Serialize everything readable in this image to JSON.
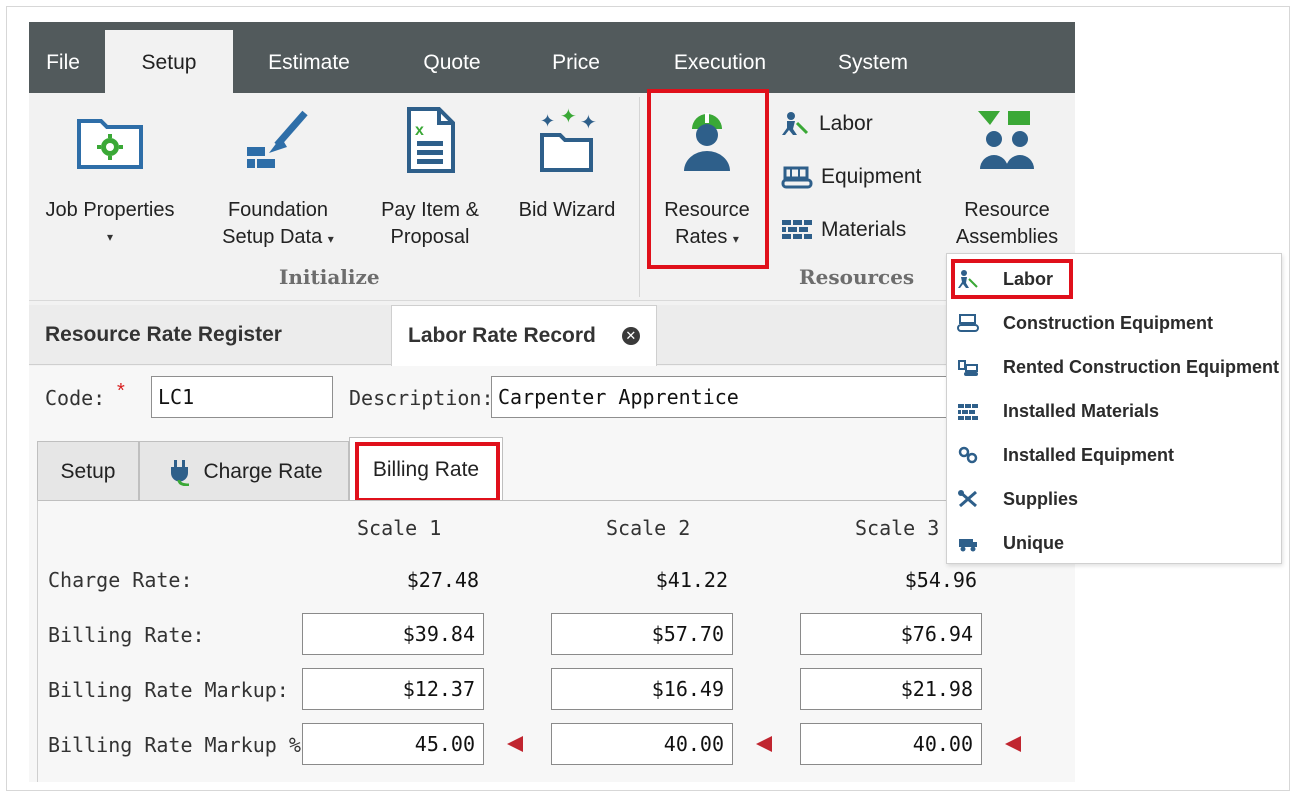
{
  "menu": {
    "tabs": [
      "File",
      "Setup",
      "Estimate",
      "Quote",
      "Price",
      "Execution",
      "System"
    ],
    "active": "Setup"
  },
  "ribbon": {
    "initialize": {
      "job_properties": "Job Properties",
      "foundation_line1": "Foundation",
      "foundation_line2": "Setup Data",
      "pay_item_line1": "Pay Item &",
      "pay_item_line2": "Proposal",
      "bid_wizard": "Bid Wizard",
      "group_label": "Initialize"
    },
    "resources": {
      "rates_line1": "Resource",
      "rates_line2": "Rates",
      "labor": "Labor",
      "equipment": "Equipment",
      "materials": "Materials",
      "assemblies_line1": "Resource",
      "assemblies_line2": "Assemblies",
      "group_label": "Resources"
    },
    "caret": "▾"
  },
  "doc_tabs": {
    "register": "Resource Rate Register",
    "record": "Labor Rate Record",
    "close": "✕"
  },
  "form": {
    "code_label": "Code:",
    "required_mark": "*",
    "code_value": "LC1",
    "description_label": "Description:",
    "description_value": "Carpenter Apprentice"
  },
  "sub_tabs": {
    "setup": "Setup",
    "charge_rate": "Charge Rate",
    "billing_rate": "Billing Rate"
  },
  "rate_grid": {
    "columns": [
      "Scale 1",
      "Scale 2",
      "Scale 3"
    ],
    "charge_rate_label": "Charge Rate:",
    "charge_rate": [
      "$27.48",
      "$41.22",
      "$54.96"
    ],
    "billing_rate_label": "Billing Rate:",
    "billing_rate": [
      "$39.84",
      "$57.70",
      "$76.94"
    ],
    "markup_label": "Billing Rate Markup:",
    "markup": [
      "$12.37",
      "$16.49",
      "$21.98"
    ],
    "markup_pct_label": "Billing Rate Markup %:",
    "markup_pct": [
      "45.00",
      "40.00",
      "40.00"
    ]
  },
  "dropdown": {
    "items": [
      "Labor",
      "Construction Equipment",
      "Rented Construction Equipment",
      "Installed Materials",
      "Installed Equipment",
      "Supplies",
      "Unique"
    ]
  },
  "colors": {
    "menubar": "#525a5c",
    "highlight": "#e0101b",
    "green": "#3aa836",
    "blue": "#2e5f8a"
  }
}
